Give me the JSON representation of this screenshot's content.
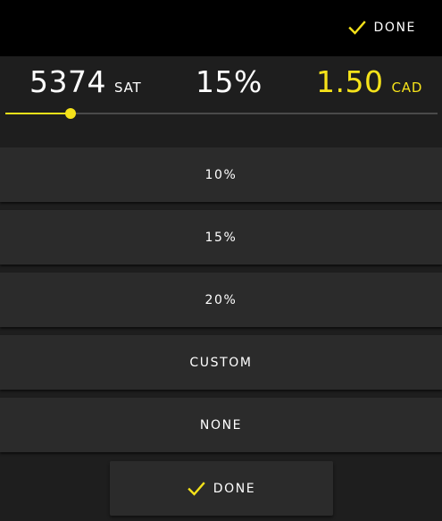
{
  "header": {
    "done_label": "DONE",
    "done_icon": "check-icon"
  },
  "amounts": {
    "sat_value": "5374",
    "sat_unit": "SAT",
    "percent_value": "15%",
    "fiat_value": "1.50",
    "fiat_unit": "CAD"
  },
  "slider": {
    "level": 0.15
  },
  "options": [
    {
      "label": "10%"
    },
    {
      "label": "15%"
    },
    {
      "label": "20%"
    },
    {
      "label": "CUSTOM"
    },
    {
      "label": "NONE"
    }
  ],
  "footer": {
    "done_label": "DONE",
    "done_icon": "check-icon"
  },
  "colors": {
    "accent": "#f5e21a",
    "background": "#1e1e1e",
    "topbar": "#000000",
    "button": "#2b2b2b",
    "track": "#4a4a4a"
  }
}
